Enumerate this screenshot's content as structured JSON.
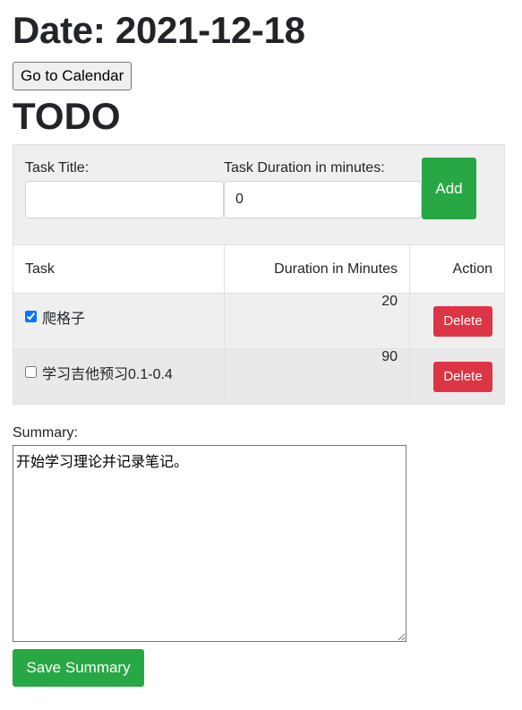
{
  "header": {
    "date_title": "Date: 2021-12-18",
    "calendar_button": "Go to Calendar",
    "todo_title": "TODO"
  },
  "form": {
    "title_label": "Task Title:",
    "title_value": "",
    "duration_label": "Task Duration in minutes:",
    "duration_value": "0",
    "add_button": "Add"
  },
  "table": {
    "headers": [
      "Task",
      "Duration in Minutes",
      "Action"
    ],
    "rows": [
      {
        "task": "爬格子",
        "checked": true,
        "duration": "20",
        "action": "Delete"
      },
      {
        "task": "学习吉他预习0.1-0.4",
        "checked": false,
        "duration": "90",
        "action": "Delete"
      }
    ]
  },
  "summary": {
    "label": "Summary:",
    "value": "开始学习理论并记录笔记。",
    "save_button": "Save Summary"
  },
  "colors": {
    "success": "#28a745",
    "danger": "#dc3545",
    "form_bg": "#efefef"
  }
}
